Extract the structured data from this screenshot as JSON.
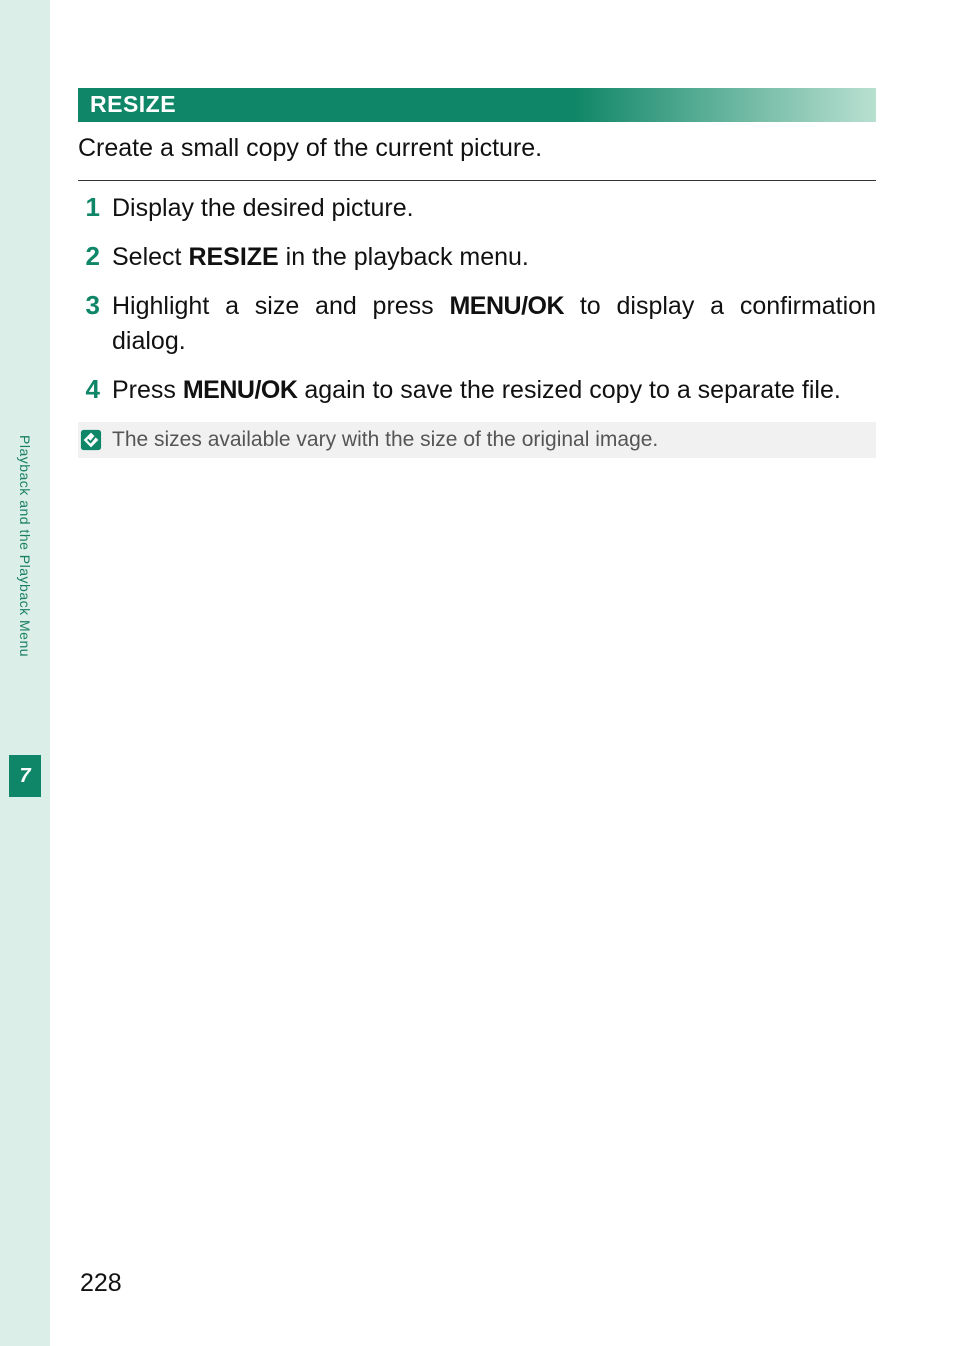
{
  "side": {
    "label": "Playback and the Playback Menu",
    "chapter": "7"
  },
  "section": {
    "title": "RESIZE",
    "intro": "Create a small copy of the current picture."
  },
  "steps": [
    {
      "num": "1",
      "parts": [
        {
          "t": "Display the desired picture."
        }
      ]
    },
    {
      "num": "2",
      "parts": [
        {
          "t": "Select "
        },
        {
          "t": "RESIZE",
          "cls": "b"
        },
        {
          "t": " in the playback menu."
        }
      ]
    },
    {
      "num": "3",
      "parts": [
        {
          "t": "Highlight a size and press "
        },
        {
          "t": "MENU/OK",
          "cls": "mono"
        },
        {
          "t": " to display a confirmation dialog."
        }
      ]
    },
    {
      "num": "4",
      "parts": [
        {
          "t": "Press "
        },
        {
          "t": "MENU/OK",
          "cls": "mono"
        },
        {
          "t": " again to save the resized copy to a separate file."
        }
      ]
    }
  ],
  "note": "The sizes available vary with the size of the original image.",
  "pageNumber": "228"
}
